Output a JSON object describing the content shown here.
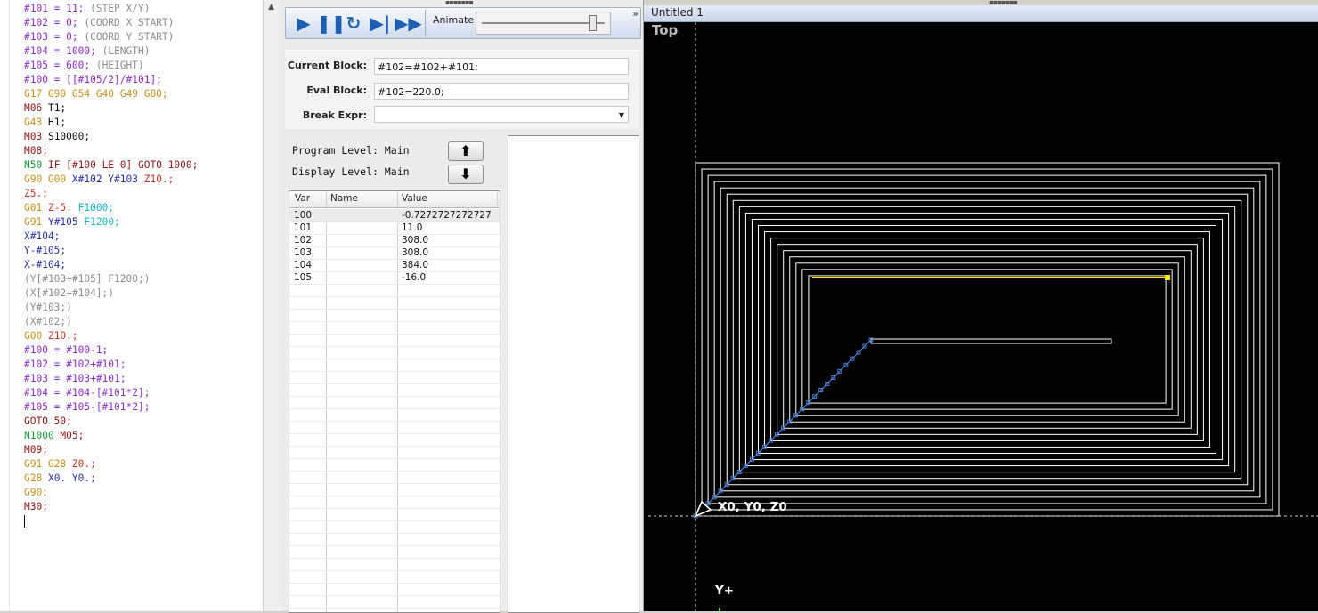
{
  "editor": {
    "lines": [
      [
        {
          "t": "#101 = 11;",
          "c": "#8b2fc9"
        },
        {
          "t": " (STEP X/Y)",
          "c": "#8c8c8c"
        }
      ],
      [
        {
          "t": "#102 = 0;",
          "c": "#8b2fc9"
        },
        {
          "t": " (COORD X START)",
          "c": "#8c8c8c"
        }
      ],
      [
        {
          "t": "#103 = 0;",
          "c": "#8b2fc9"
        },
        {
          "t": " (COORD Y START)",
          "c": "#8c8c8c"
        }
      ],
      [
        {
          "t": "#104 = 1000;",
          "c": "#8b2fc9"
        },
        {
          "t": " (LENGTH)",
          "c": "#8c8c8c"
        }
      ],
      [
        {
          "t": "#105 = 600;",
          "c": "#8b2fc9"
        },
        {
          "t": " (HEIGHT)",
          "c": "#8c8c8c"
        }
      ],
      [
        {
          "t": "#100 = [[#105/2]/#101];",
          "c": "#8b2fc9"
        }
      ],
      [
        {
          "t": "G17 G90 G54 G40 G49 G80;",
          "c": "#c9901e"
        }
      ],
      [
        {
          "t": "M06 ",
          "c": "#8b1a1a"
        },
        {
          "t": "T1;",
          "c": "#111111"
        }
      ],
      [
        {
          "t": "G43 ",
          "c": "#c9901e"
        },
        {
          "t": "H1;",
          "c": "#111111"
        }
      ],
      [
        {
          "t": "M03 ",
          "c": "#8b1a1a"
        },
        {
          "t": "S10000;",
          "c": "#111111"
        }
      ],
      [
        {
          "t": "M08;",
          "c": "#8b1a1a"
        }
      ],
      [
        {
          "t": "N50 ",
          "c": "#1a9b3a"
        },
        {
          "t": "IF [#100 LE 0] GOTO 1000;",
          "c": "#8b1a1a"
        }
      ],
      [
        {
          "t": "G90 G00 ",
          "c": "#c9901e"
        },
        {
          "t": "X#102 Y#103 ",
          "c": "#2a33a8"
        },
        {
          "t": "Z10.;",
          "c": "#c0392b"
        }
      ],
      [
        {
          "t": "Z5.;",
          "c": "#c0392b"
        }
      ],
      [
        {
          "t": "G01 ",
          "c": "#c9901e"
        },
        {
          "t": "Z-5. ",
          "c": "#c0392b"
        },
        {
          "t": "F1000;",
          "c": "#14b8c4"
        }
      ],
      [
        {
          "t": "G91 ",
          "c": "#c9901e"
        },
        {
          "t": "Y#105 ",
          "c": "#2a33a8"
        },
        {
          "t": "F1200;",
          "c": "#14b8c4"
        }
      ],
      [
        {
          "t": "X#104;",
          "c": "#2a33a8"
        }
      ],
      [
        {
          "t": "Y-#105;",
          "c": "#2a33a8"
        }
      ],
      [
        {
          "t": "X-#104;",
          "c": "#2a33a8"
        }
      ],
      [
        {
          "t": "(Y[#103+#105] F1200;)",
          "c": "#8c8c8c"
        }
      ],
      [
        {
          "t": "(X[#102+#104];)",
          "c": "#8c8c8c"
        }
      ],
      [
        {
          "t": "(Y#103;)",
          "c": "#8c8c8c"
        }
      ],
      [
        {
          "t": "(X#102;)",
          "c": "#8c8c8c"
        }
      ],
      [
        {
          "t": "G00 ",
          "c": "#c9901e"
        },
        {
          "t": "Z10.;",
          "c": "#c0392b"
        }
      ],
      [
        {
          "t": "#100 = #100-1;",
          "c": "#8b2fc9"
        }
      ],
      [
        {
          "t": "#102 = #102+#101;",
          "c": "#8b2fc9"
        }
      ],
      [
        {
          "t": "#103 = #103+#101;",
          "c": "#8b2fc9"
        }
      ],
      [
        {
          "t": "#104 = #104-[#101*2];",
          "c": "#8b2fc9"
        }
      ],
      [
        {
          "t": "#105 = #105-[#101*2];",
          "c": "#8b2fc9"
        }
      ],
      [
        {
          "t": "GOTO 50;",
          "c": "#8b1a1a"
        }
      ],
      [
        {
          "t": "N1000 ",
          "c": "#1a9b3a"
        },
        {
          "t": "M05;",
          "c": "#8b1a1a"
        }
      ],
      [
        {
          "t": "M09;",
          "c": "#8b1a1a"
        }
      ],
      [
        {
          "t": "G91 G28 ",
          "c": "#c9901e"
        },
        {
          "t": "Z0.;",
          "c": "#c0392b"
        }
      ],
      [
        {
          "t": "G28 ",
          "c": "#c9901e"
        },
        {
          "t": "X0. Y0.;",
          "c": "#2a33a8"
        }
      ],
      [
        {
          "t": "G90;",
          "c": "#c9901e"
        }
      ],
      [
        {
          "t": "M30;",
          "c": "#8b1a1a"
        }
      ],
      [
        {
          "t": "",
          "c": "#111111"
        }
      ]
    ]
  },
  "toolbar": {
    "play_icon": "play-icon",
    "pause_icon": "pause-icon",
    "restart_icon": "restart-icon",
    "step_icon": "step-icon",
    "fast_icon": "fast-forward-icon",
    "animate_label": "Animate",
    "animate_speed": 0.92
  },
  "blocks": {
    "current_label": "Current Block:",
    "current_value": "#102=#102+#101;",
    "eval_label": "Eval Block:",
    "eval_value": "#102=220.0;",
    "break_label": "Break Expr:",
    "break_value": ""
  },
  "levels": {
    "program": "Program Level: Main",
    "display": "Display Level: Main"
  },
  "variables": {
    "headers": [
      "Var",
      "Name",
      "Value"
    ],
    "rows": [
      {
        "var": "100",
        "name": "",
        "value": "-0.7272727272727"
      },
      {
        "var": "101",
        "name": "",
        "value": "11.0"
      },
      {
        "var": "102",
        "name": "",
        "value": "308.0"
      },
      {
        "var": "103",
        "name": "",
        "value": "308.0"
      },
      {
        "var": "104",
        "name": "",
        "value": "384.0"
      },
      {
        "var": "105",
        "name": "",
        "value": "-16.0"
      }
    ]
  },
  "viewport": {
    "window_title": "Untitled 1",
    "view_name": "Top",
    "origin_label": "X0, Y0, Z0",
    "axis_label": "Y+",
    "colors": {
      "background": "#000000",
      "toolpath": "#ffffff",
      "active": "#ffe600",
      "rapid": "#4a7fd6"
    }
  }
}
